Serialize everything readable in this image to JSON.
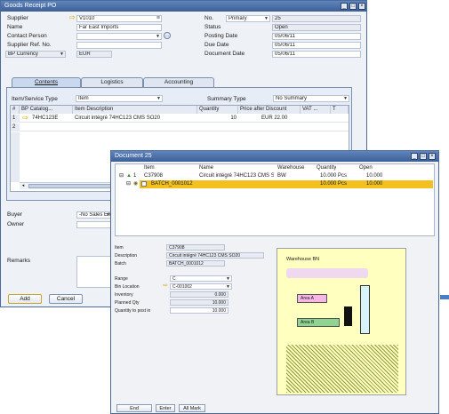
{
  "goods_receipt": {
    "title": "Goods Receipt PO",
    "header": {
      "supplier_label": "Supplier",
      "supplier_value": "V1010",
      "name_label": "Name",
      "name_value": "Far East Imports",
      "contact_label": "Contact Person",
      "ref_label": "Supplier Ref. No.",
      "currency_label": "BP Currency",
      "currency_value": "EUR",
      "no_label": "No.",
      "no_series": "Primary",
      "no_value": "25",
      "status_label": "Status",
      "status_value": "Open",
      "posting_label": "Posting Date",
      "posting_value": "05/06/11",
      "due_label": "Due Date",
      "due_value": "05/06/11",
      "doc_date_label": "Document Date",
      "doc_date_value": "05/06/11"
    },
    "tabs": [
      "Contents",
      "Logistics",
      "Accounting"
    ],
    "item_type_label": "Item/Service Type",
    "item_type_value": "Item",
    "summary_type_label": "Summary Type",
    "summary_type_value": "No Summary",
    "columns": [
      "#",
      "BP Catalog...",
      "Item Description",
      "Quantity",
      "Price after Discount",
      "VAT ...",
      "T"
    ],
    "rows": [
      {
        "num": "1",
        "catalog": "74HC123E",
        "desc": "Circuit intégré 74HC123 CMS SO20",
        "qty": "10",
        "price": "EUR 22.00"
      },
      {
        "num": "2",
        "catalog": "",
        "desc": "",
        "qty": "",
        "price": ""
      }
    ],
    "buyer_label": "Buyer",
    "buyer_value": "-No Sales Em",
    "owner_label": "Owner",
    "remarks_label": "Remarks",
    "add_button": "Add",
    "cancel_button": "Cancel"
  },
  "document": {
    "title": "Document 25",
    "columns": [
      "Item",
      "Name",
      "Warehouse",
      "Quantity",
      "Open"
    ],
    "row": {
      "num": "1",
      "item": "C37908",
      "name": "Circuit intégré 74HC123 CMS SO2",
      "warehouse": "BW",
      "quantity": "10.000 Pcs",
      "open": "10.000"
    },
    "batch": {
      "code": "BATCH_0001012",
      "quantity": "10.000 Pcs",
      "open": "10.000"
    },
    "details": {
      "item_label": "Item",
      "item_value": "C37908",
      "desc_label": "Description",
      "desc_value": "Circuit intégré 74HC123 CMS SO20",
      "batch_label": "Batch",
      "batch_value": "BATCH_0001012",
      "range_label": "Range",
      "range_value": "C",
      "bin_label": "Bin Location",
      "bin_value": "C-001002",
      "inventory_label": "Inventory",
      "inventory_value": "0.000",
      "planned_label": "Planned Qty",
      "planned_value": "10.000",
      "post_label": "Quantity to post in",
      "post_value": "10.000"
    },
    "warehouse_title": "Warehouse BN",
    "area_a": "Area A",
    "area_b": "Area B",
    "end_button": "End",
    "enter_button": "Enter",
    "allmark_button": "All Mark"
  },
  "colors": {
    "titlebar": "#4a6fa8",
    "selected_row": "#f4c020",
    "area_a": "#f7b6e8",
    "area_b": "#8fd48f",
    "warehouse_bg": "#ffffc0",
    "hatch": "#8c9c3c"
  }
}
